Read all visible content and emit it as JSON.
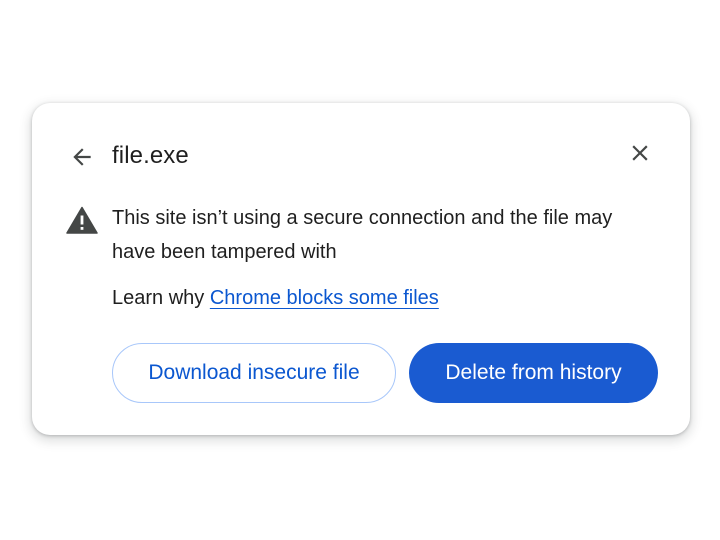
{
  "dialog": {
    "title": "file.exe",
    "message": "This site isn’t using a secure connection and the file may have been tampered with",
    "learn_prefix": "Learn why ",
    "learn_link": "Chrome blocks some files",
    "buttons": {
      "download_insecure": "Download insecure file",
      "delete_from_history": "Delete from history"
    },
    "icons": {
      "back": "arrow-left-icon",
      "close": "close-icon",
      "warning": "warning-triangle-icon"
    }
  },
  "colors": {
    "primary": "#0b57d0",
    "primary_filled": "#1a5bd1",
    "outline_border": "#a8c7fa",
    "text": "#1f1f1f",
    "icon": "#444746"
  }
}
